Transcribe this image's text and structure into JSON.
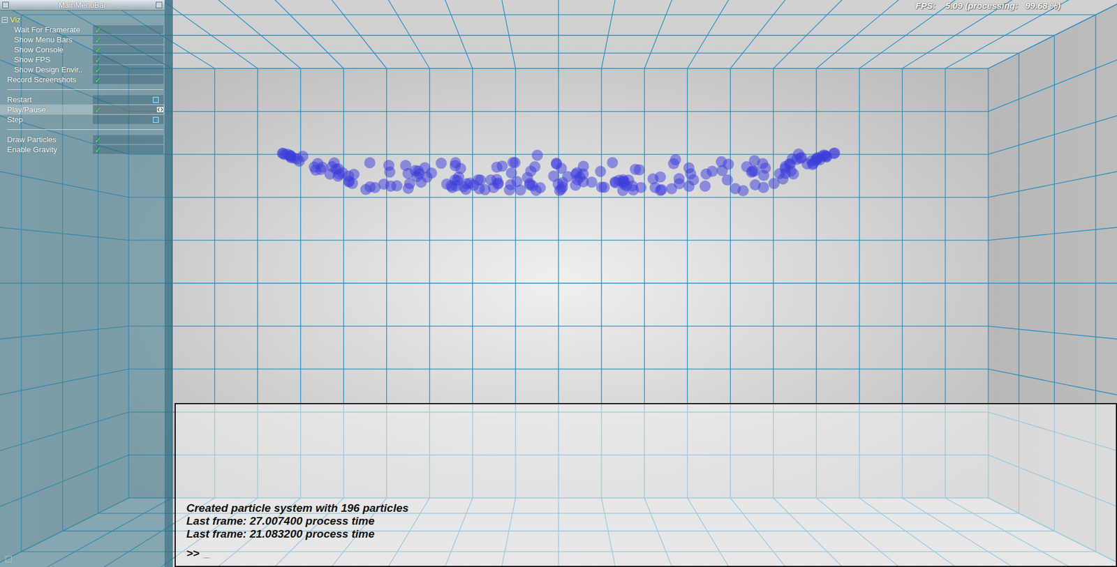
{
  "menu": {
    "title": "MainMenuBar",
    "check_mark": "✓",
    "groups": [
      {
        "items": [
          {
            "kind": "folder",
            "label": "Viz",
            "expanded": true,
            "selected": false,
            "children": [
              {
                "kind": "toggle",
                "label": "Wait For Framerate",
                "checked": true,
                "selected": false
              },
              {
                "kind": "toggle",
                "label": "Show Menu Bars",
                "checked": true,
                "selected": false
              },
              {
                "kind": "toggle",
                "label": "Show Console",
                "checked": true,
                "selected": false
              },
              {
                "kind": "toggle",
                "label": "Show FPS",
                "checked": true,
                "selected": false
              },
              {
                "kind": "toggle",
                "label": "Show Design Envir..",
                "checked": true,
                "selected": false
              }
            ]
          },
          {
            "kind": "toggle",
            "label": "Record Screenshots",
            "checked": true,
            "selected": false
          }
        ]
      },
      {
        "items": [
          {
            "kind": "button",
            "label": "Restart",
            "selected": false
          },
          {
            "kind": "toggle",
            "label": "Play/Pause",
            "checked": true,
            "selected": true
          },
          {
            "kind": "button",
            "label": "Step",
            "selected": false
          }
        ]
      },
      {
        "items": [
          {
            "kind": "toggle",
            "label": "Draw Particles",
            "checked": true,
            "selected": false
          },
          {
            "kind": "toggle",
            "label": "Enable Gravity",
            "checked": true,
            "selected": false
          }
        ]
      }
    ]
  },
  "fps": {
    "text": "FPS:    5.09 (processing:   99.68 %)"
  },
  "console": {
    "lines": [
      "Created particle system with 196 particles",
      "Last frame: 27.007400 process time",
      "Last frame: 21.083200 process time"
    ],
    "prompt": ">>",
    "cursor": "_"
  }
}
